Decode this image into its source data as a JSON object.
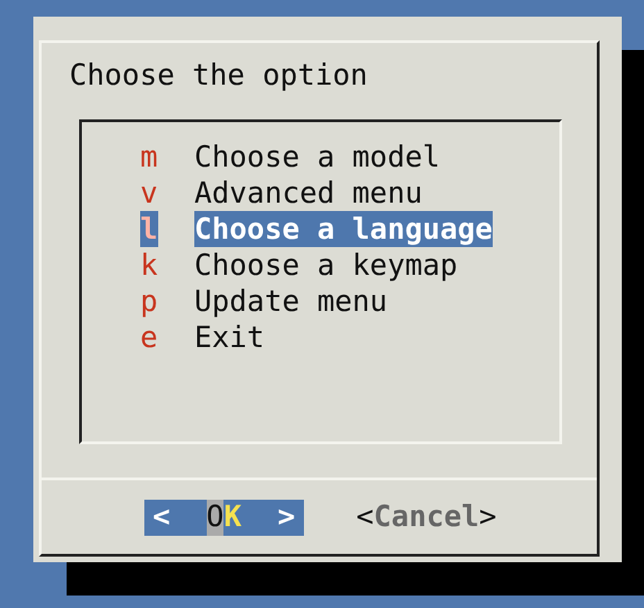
{
  "dialog": {
    "title": "Choose the option",
    "items": [
      {
        "key": "m",
        "label": "Choose a model",
        "selected": false
      },
      {
        "key": "v",
        "label": "Advanced menu",
        "selected": false
      },
      {
        "key": "l",
        "label": "Choose a language",
        "selected": true
      },
      {
        "key": "k",
        "label": "Choose a keymap",
        "selected": false
      },
      {
        "key": "p",
        "label": "Update menu",
        "selected": false
      },
      {
        "key": "e",
        "label": "Exit",
        "selected": false
      }
    ],
    "buttons": [
      {
        "open": "<",
        "label": "OK",
        "close": ">",
        "selected": true
      },
      {
        "open": "<",
        "label": "Cancel",
        "close": ">",
        "selected": false
      }
    ]
  }
}
